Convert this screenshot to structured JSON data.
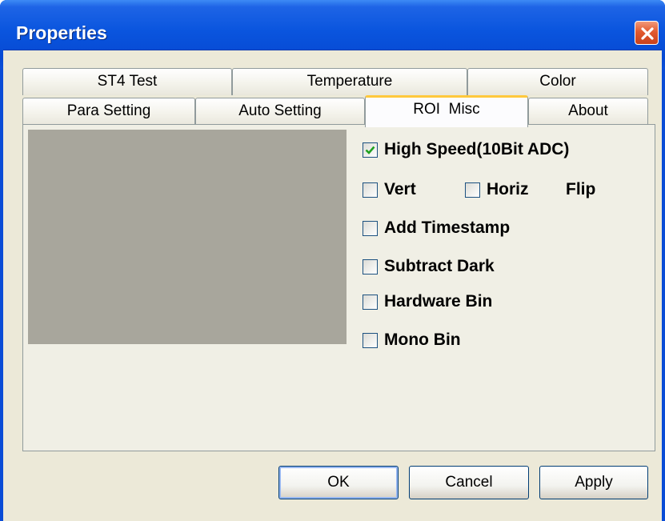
{
  "window": {
    "title": "Properties",
    "close_icon": "close-icon"
  },
  "tabs_row_back": [
    {
      "label": "ST4 Test"
    },
    {
      "label": "Temperature"
    },
    {
      "label": "Color"
    }
  ],
  "tabs_row_front": [
    {
      "label": "Para Setting"
    },
    {
      "label": "Auto Setting"
    },
    {
      "label": "ROI  Misc",
      "active": true
    },
    {
      "label": "About"
    }
  ],
  "options": {
    "high_speed": {
      "label": "High Speed(10Bit ADC)",
      "checked": true
    },
    "vert": {
      "label": "Vert",
      "checked": false
    },
    "horiz": {
      "label": "Horiz",
      "checked": false
    },
    "flip_label": "Flip",
    "add_timestamp": {
      "label": "Add Timestamp",
      "checked": false
    },
    "subtract_dark": {
      "label": "Subtract Dark",
      "checked": false
    },
    "hardware_bin": {
      "label": "Hardware Bin",
      "checked": false
    },
    "mono_bin": {
      "label": "Mono Bin",
      "checked": false
    }
  },
  "buttons": {
    "ok": "OK",
    "cancel": "Cancel",
    "apply": "Apply"
  },
  "colors": {
    "titlebar": "#0a55de",
    "dialog_bg": "#ece9d8",
    "preview": "#a8a69c",
    "active_tab_accent": "#ffc83c",
    "checkmark": "#21a121"
  }
}
